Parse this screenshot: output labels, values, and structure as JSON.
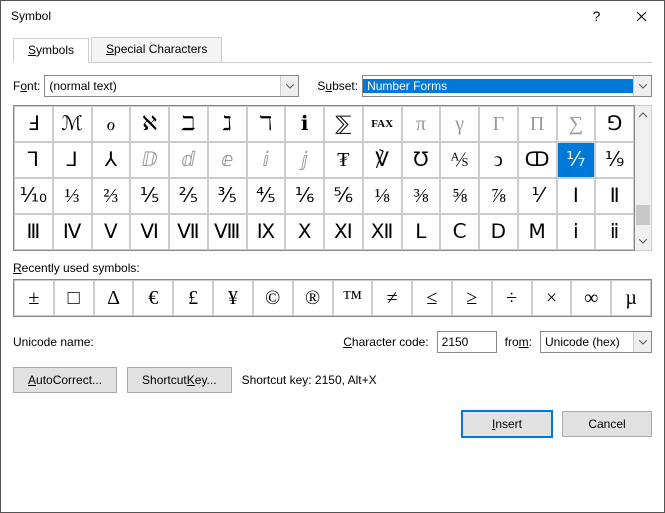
{
  "window": {
    "title": "Symbol"
  },
  "tabs": {
    "symbols": "Symbols",
    "special": "Special Characters"
  },
  "font": {
    "label_pre": "F",
    "label_ul": "o",
    "label_post": "nt:",
    "value": "(normal text)"
  },
  "subset": {
    "label_pre": "S",
    "label_ul": "u",
    "label_post": "bset:",
    "value": "Number Forms"
  },
  "grid": {
    "rows": [
      [
        "Ⅎ",
        "ℳ",
        "ℴ",
        "ℵ",
        "ℶ",
        "ℷ",
        "ℸ",
        "ℹ",
        "⅀",
        "FAX",
        "π",
        "γ",
        "Γ",
        "Π",
        "∑",
        "⅁"
      ],
      [
        "⅂",
        "⅃",
        "⅄",
        "ⅅ",
        "ⅆ",
        "ⅇ",
        "ⅈ",
        "ⅉ",
        "₮",
        "℣",
        "℧",
        "⅍",
        "ↄ",
        "ↀ",
        "⅐",
        "⅑"
      ],
      [
        "⅒",
        "⅓",
        "⅔",
        "⅕",
        "⅖",
        "⅗",
        "⅘",
        "⅙",
        "⅚",
        "⅛",
        "⅜",
        "⅝",
        "⅞",
        "⅟",
        "Ⅰ",
        "Ⅱ"
      ],
      [
        "Ⅲ",
        "Ⅳ",
        "Ⅴ",
        "Ⅵ",
        "Ⅶ",
        "Ⅷ",
        "Ⅸ",
        "Ⅹ",
        "Ⅺ",
        "Ⅻ",
        "Ⅼ",
        "Ⅽ",
        "Ⅾ",
        "Ⅿ",
        "ⅰ",
        "ⅱ"
      ]
    ],
    "selected": [
      1,
      14
    ]
  },
  "recent": {
    "label_ul": "R",
    "label_post": "ecently used symbols:",
    "items": [
      "±",
      "□",
      "Δ",
      "€",
      "£",
      "¥",
      "©",
      "®",
      "™",
      "≠",
      "≤",
      "≥",
      "÷",
      "×",
      "∞",
      "µ"
    ]
  },
  "unicode": {
    "label": "Unicode name:"
  },
  "charcode": {
    "label_ul": "C",
    "label_post": "haracter code:",
    "value": "2150"
  },
  "from": {
    "label_pre": "fro",
    "label_ul": "m",
    "label_post": ":",
    "value": "Unicode (hex)"
  },
  "buttons": {
    "autocorrect_ul": "A",
    "autocorrect_post": "utoCorrect...",
    "shortcut_pre": "Shortcut ",
    "shortcut_ul": "K",
    "shortcut_post": "ey...",
    "shortcut_info": "Shortcut key: 2150, Alt+X",
    "insert_ul": "I",
    "insert_post": "nsert",
    "cancel": "Cancel"
  }
}
